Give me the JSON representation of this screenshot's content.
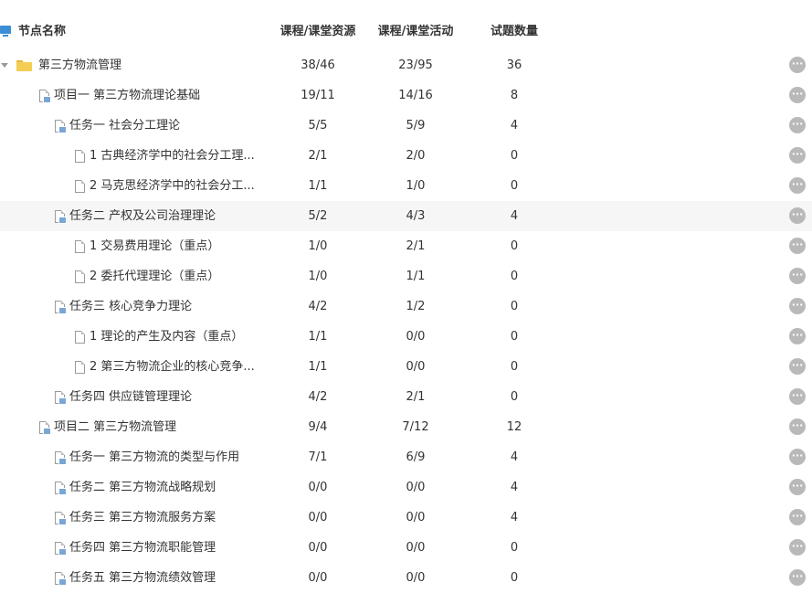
{
  "header": {
    "name_col": "节点名称",
    "col1": "课程/课堂资源",
    "col2": "课程/课堂活动",
    "col3": "试题数量"
  },
  "rows": [
    {
      "name": "第三方物流管理",
      "res": "38/46",
      "act": "23/95",
      "qty": "36"
    },
    {
      "name": "项目一 第三方物流理论基础",
      "res": "19/11",
      "act": "14/16",
      "qty": "8"
    },
    {
      "name": "任务一 社会分工理论",
      "res": "5/5",
      "act": "5/9",
      "qty": "4"
    },
    {
      "name": "1 古典经济学中的社会分工理...",
      "res": "2/1",
      "act": "2/0",
      "qty": "0"
    },
    {
      "name": "2 马克思经济学中的社会分工...",
      "res": "1/1",
      "act": "1/0",
      "qty": "0"
    },
    {
      "name": "任务二 产权及公司治理理论",
      "res": "5/2",
      "act": "4/3",
      "qty": "4"
    },
    {
      "name": "1 交易费用理论（重点）",
      "res": "1/0",
      "act": "2/1",
      "qty": "0"
    },
    {
      "name": "2 委托代理理论（重点）",
      "res": "1/0",
      "act": "1/1",
      "qty": "0"
    },
    {
      "name": "任务三 核心竞争力理论",
      "res": "4/2",
      "act": "1/2",
      "qty": "0"
    },
    {
      "name": "1 理论的产生及内容（重点）",
      "res": "1/1",
      "act": "0/0",
      "qty": "0"
    },
    {
      "name": "2 第三方物流企业的核心竞争...",
      "res": "1/1",
      "act": "0/0",
      "qty": "0"
    },
    {
      "name": "任务四 供应链管理理论",
      "res": "4/2",
      "act": "2/1",
      "qty": "0"
    },
    {
      "name": "项目二 第三方物流管理",
      "res": "9/4",
      "act": "7/12",
      "qty": "12"
    },
    {
      "name": "任务一 第三方物流的类型与作用",
      "res": "7/1",
      "act": "6/9",
      "qty": "4"
    },
    {
      "name": "任务二 第三方物流战略规划",
      "res": "0/0",
      "act": "0/0",
      "qty": "4"
    },
    {
      "name": "任务三 第三方物流服务方案",
      "res": "0/0",
      "act": "0/0",
      "qty": "4"
    },
    {
      "name": "任务四 第三方物流职能管理",
      "res": "0/0",
      "act": "0/0",
      "qty": "0"
    },
    {
      "name": "任务五 第三方物流绩效管理",
      "res": "0/0",
      "act": "0/0",
      "qty": "0"
    }
  ]
}
